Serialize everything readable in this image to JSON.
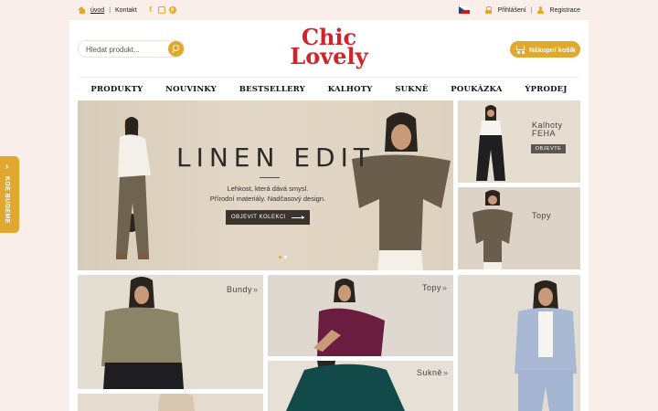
{
  "topbar": {
    "home_label": "úvod",
    "contact_label": "Kontakt",
    "separator": "|",
    "social": [
      "facebook-icon",
      "instagram-icon",
      "pinterest-icon"
    ],
    "login_label": "Přihlášení",
    "register_label": "Registrace",
    "language": "cs"
  },
  "search": {
    "placeholder": "Hledat produkt..."
  },
  "logo": {
    "line1": "Chic",
    "line2": "Lovely"
  },
  "cart": {
    "label": "Nákupní košík"
  },
  "nav": {
    "items": [
      "PRODUKTY",
      "NOUVINKY",
      "BESTSELLERY",
      "KALHOTY",
      "SUKNĚ",
      "POUKÁZKA",
      "ÝPRODEJ"
    ]
  },
  "hero": {
    "title": "LINEN EDIT",
    "subtitle_line1": "Lehkost, která dává smysl.",
    "subtitle_line2": "Přírodní materiály. Nadčasový design.",
    "cta": "OBJEVIT KOLEKCI"
  },
  "tiles": {
    "kalhoty_line1": "Kalhoty",
    "kalhoty_line2": "FEHA",
    "kalhoty_cta": "OBJEVTE",
    "topy_right": "Topy",
    "bundy": "Bundy",
    "topy": "Topy",
    "sukne": "Sukně"
  },
  "side_badge": {
    "label": "KDE BUDEME"
  },
  "colors": {
    "accent": "#e0a82e",
    "brand_red": "#d2232a",
    "page_bg": "#faeeea"
  }
}
